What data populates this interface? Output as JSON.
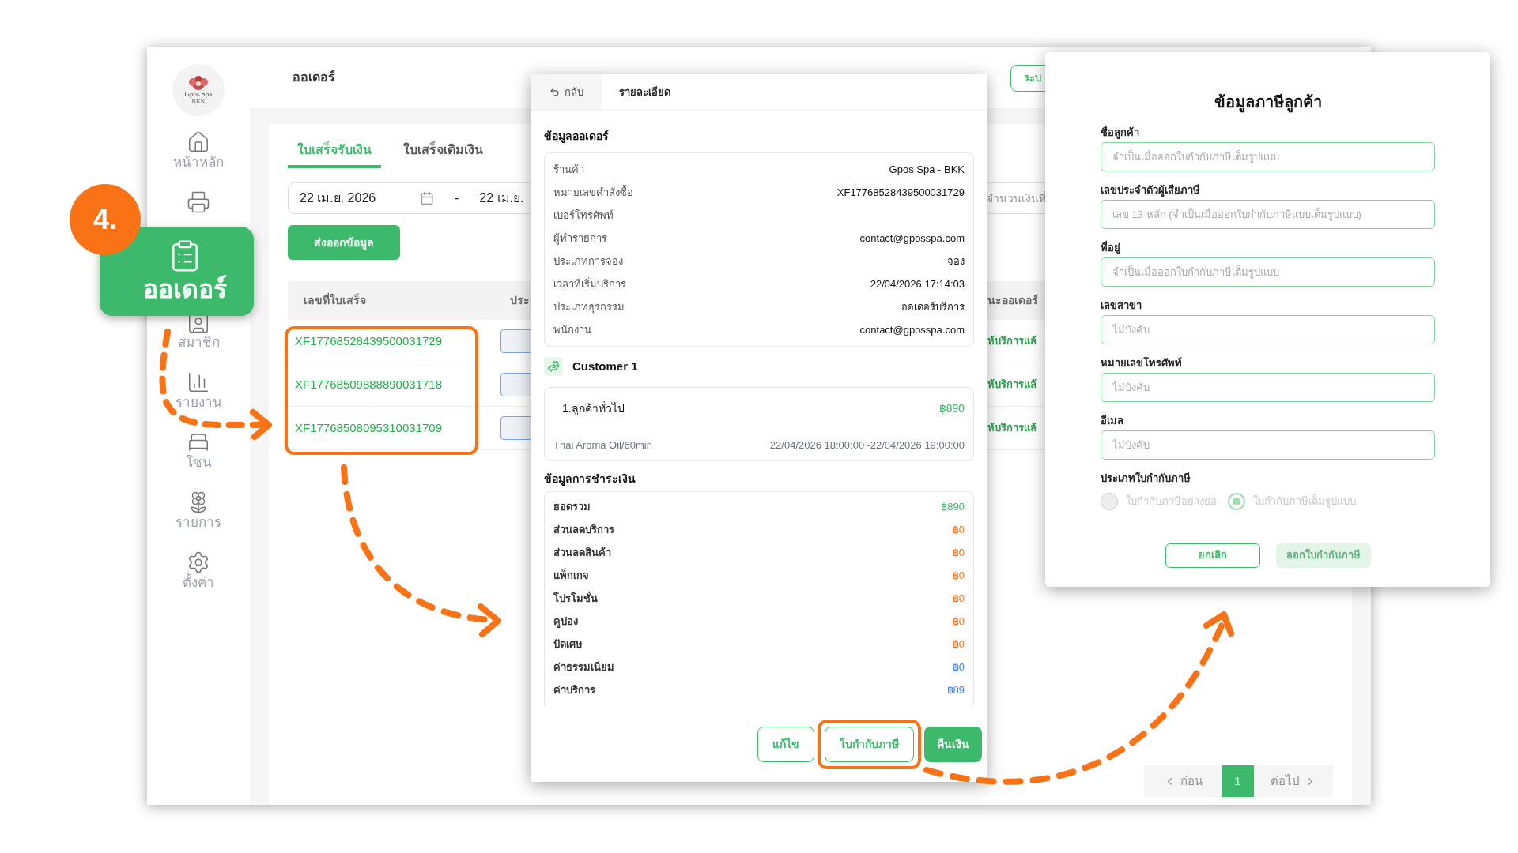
{
  "callout": {
    "step": "4.",
    "label": "ออเดอร์"
  },
  "sidebar": {
    "logo": {
      "name": "Gpos Spa",
      "branch": "BKK"
    },
    "items": [
      {
        "kind": "labeled",
        "label": "หน้าหลัก"
      },
      {
        "kind": "icon_only"
      },
      {
        "kind": "labeled",
        "label": "สมาชิก"
      },
      {
        "kind": "labeled",
        "label": "รายงาน"
      },
      {
        "kind": "labeled",
        "label": "โซน"
      },
      {
        "kind": "labeled",
        "label": "รายการ"
      },
      {
        "kind": "labeled",
        "label": "ตั้งค่า"
      }
    ]
  },
  "header": {
    "title": "ออเดอร์",
    "action_button": "ระบ"
  },
  "tabs": [
    {
      "label": "ใบเสร็จรับเงิน",
      "selected": true
    },
    {
      "label": "ใบเสร็จเติมเงิน",
      "selected": false
    }
  ],
  "filters": {
    "date_from": "22 เม.ย. 2026",
    "separator": "-",
    "date_to": "22 เม.ย.",
    "search_placeholder": "จำนวนเงินที่"
  },
  "export_button": "ส่งออกข้อมูล",
  "table": {
    "columns": [
      "เลขที่ใบเสร็จ",
      "ประ",
      "นะออเดอร์"
    ],
    "rows": [
      {
        "receipt": "XF17768528439500031729",
        "status": "ห้บริการแล้"
      },
      {
        "receipt": "XF17768509888890031718",
        "status": "ห้บริการแล้"
      },
      {
        "receipt": "XF17768508095310031709",
        "status": "ห้บริการแล้"
      }
    ]
  },
  "pagination": {
    "prev": {
      "label": "ก่อน",
      "disabled": true
    },
    "pages": [
      {
        "label": "1",
        "selected": true
      }
    ],
    "next": {
      "label": "ต่อไป",
      "disabled": true
    }
  },
  "detail_modal": {
    "back": "กลับ",
    "title": "รายละเอียด",
    "order_section": "ข้อมูลออเดอร์",
    "order_fields": [
      {
        "label": "ร้านค้า",
        "value": "Gpos Spa - BKK"
      },
      {
        "label": "หมายเลขคำสั่งซื้อ",
        "value": "XF17768528439500031729"
      },
      {
        "label": "เบอร์โทรศัพท์"
      },
      {
        "label": "ผู้ทำรายการ",
        "value": "contact@gposspa.com"
      },
      {
        "label": "ประเภทการจอง",
        "value": "จอง"
      },
      {
        "label": "เวลาที่เริ่มบริการ",
        "value": "22/04/2026 17:14:03"
      },
      {
        "label": "ประเภทธุรกรรม",
        "value": "ออเดอร์บริการ"
      },
      {
        "label": "พนักงาน",
        "value": "contact@gposspa.com"
      }
    ],
    "customer": {
      "title": "Customer 1",
      "name": "1.ลูกค้าทั่วไป",
      "price": "฿890",
      "service": "Thai Aroma Oil/60min",
      "time": "22/04/2026 18:00:00~22/04/2026 19:00:00"
    },
    "payment_section": "ข้อมูลการชำระเงิน",
    "payment_rows": [
      {
        "label": "ยอดรวม",
        "value": "฿890",
        "color": "#3cb96a"
      },
      {
        "label": "ส่วนลดบริการ",
        "value": "฿0",
        "color": "#f97316"
      },
      {
        "label": "ส่วนลดสินค้า",
        "value": "฿0",
        "color": "#f97316"
      },
      {
        "label": "แพ็กเกจ",
        "value": "฿0",
        "color": "#f97316"
      },
      {
        "label": "โปรโมชั่น",
        "value": "฿0",
        "color": "#f97316"
      },
      {
        "label": "คูปอง",
        "value": "฿0",
        "color": "#f97316"
      },
      {
        "label": "ปัดเศษ",
        "value": "฿0",
        "color": "#f97316"
      },
      {
        "label": "ค่าธรรมเนียม",
        "value": "฿0",
        "color": "#3b82f6"
      },
      {
        "label": "ค่าบริการ",
        "value": "฿89",
        "color": "#3b82f6"
      }
    ],
    "buttons": [
      {
        "label": "แก้ไข",
        "kind": "outline",
        "highlighted": false
      },
      {
        "label": "ใบกำกับภาษี",
        "kind": "outline",
        "highlighted": true
      },
      {
        "label": "คืนเงิน",
        "kind": "solid",
        "highlighted": false
      }
    ]
  },
  "tax_modal": {
    "title": "ข้อมูลภาษีลูกค้า",
    "fields": [
      {
        "label": "ชื่อลูกค้า",
        "placeholder": "จำเป็นเมื่อออกใบกำกับภาษีเต็มรูปแบบ"
      },
      {
        "label": "เลขประจำตัวผู้เสียภาษี",
        "placeholder": "เลข 13 หลัก (จำเป็นเมื่อออกใบกำกับภาษีแบบเต็มรูปแบบ)"
      },
      {
        "label": "ที่อยู่",
        "placeholder": "จำเป็นเมื่อออกใบกำกับภาษีเต็มรูปแบบ"
      },
      {
        "label": "เลขสาขา",
        "placeholder": "ไม่บังคับ"
      },
      {
        "label": "หมายเลขโทรศัพท์",
        "placeholder": "ไม่บังคับ"
      },
      {
        "label": "อีเมล",
        "placeholder": "ไม่บังคับ"
      }
    ],
    "invoice_type": {
      "label": "ประเภทใบกำกับภาษี",
      "disabled": true,
      "options": [
        {
          "label": "ใบกำกับภาษีอย่างย่อ",
          "selected": false
        },
        {
          "label": "ใบกำกับภาษีเต็มรูปแบบ",
          "selected": true
        }
      ]
    },
    "buttons": [
      {
        "label": "ยกเลิก",
        "kind": "outline",
        "disabled": false
      },
      {
        "label": "ออกใบกำกับภาษี",
        "kind": "solid",
        "disabled": true
      }
    ]
  }
}
